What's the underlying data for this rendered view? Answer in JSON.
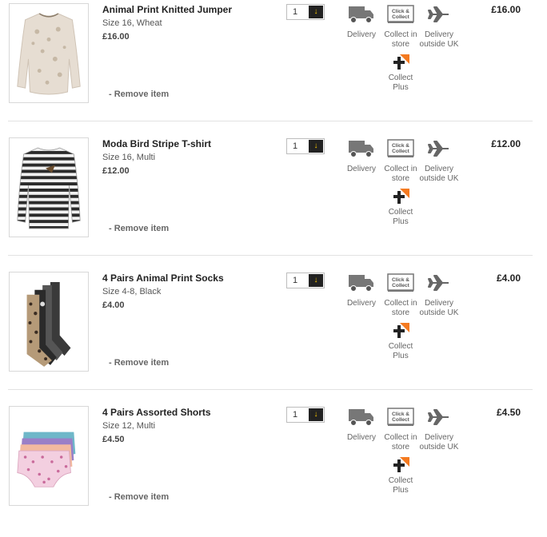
{
  "labels": {
    "remove": "- Remove item",
    "delivery": "Delivery",
    "collect_in_store": "Collect in store",
    "delivery_outside_uk": "Delivery outside UK",
    "collect_plus": "Collect Plus",
    "click_collect_line1": "Click &",
    "click_collect_line2": "Collect"
  },
  "colors": {
    "qty_button_bg": "#222222",
    "qty_arrow": "#f5c400",
    "collect_plus_accent": "#f47a20"
  },
  "items": [
    {
      "name": "Animal Print Knitted Jumper",
      "meta": "Size 16, Wheat",
      "unit_price": "£16.00",
      "qty": "1",
      "price": "£16.00"
    },
    {
      "name": "Moda Bird Stripe T-shirt",
      "meta": "Size 16, Multi",
      "unit_price": "£12.00",
      "qty": "1",
      "price": "£12.00"
    },
    {
      "name": "4 Pairs Animal Print Socks",
      "meta": "Size 4-8, Black",
      "unit_price": "£4.00",
      "qty": "1",
      "price": "£4.00"
    },
    {
      "name": "4 Pairs Assorted Shorts",
      "meta": "Size 12, Multi",
      "unit_price": "£4.50",
      "qty": "1",
      "price": "£4.50"
    }
  ]
}
